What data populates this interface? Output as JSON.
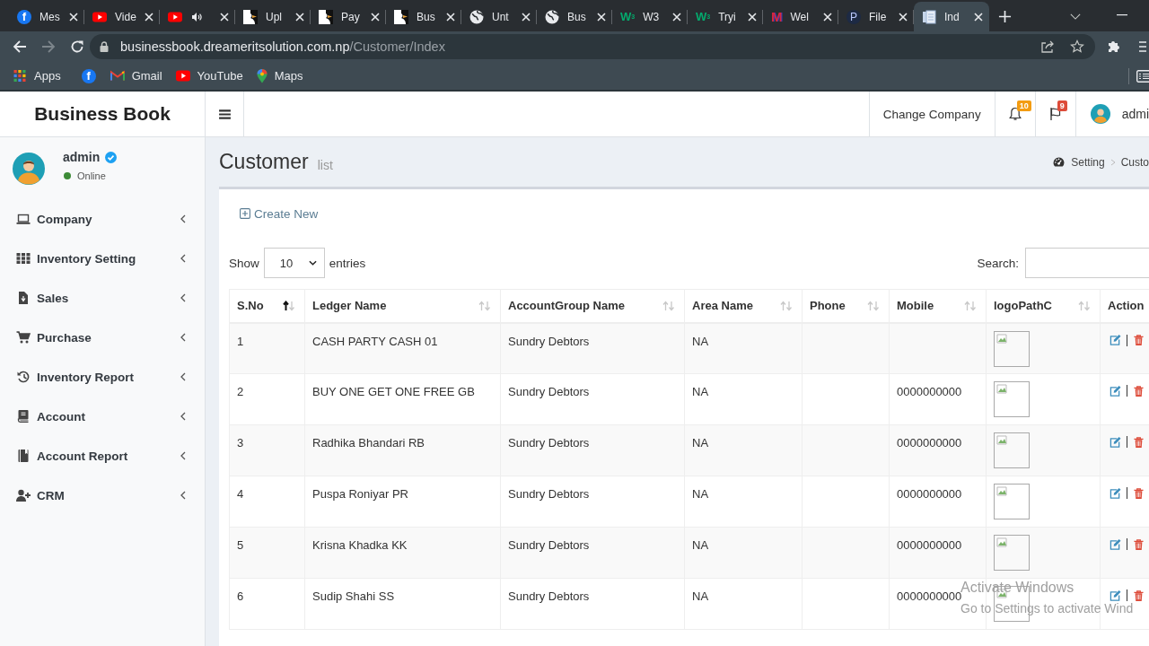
{
  "browser": {
    "tabs": [
      {
        "kind": "fb",
        "mark": "f",
        "title": "Mes",
        "audio": false,
        "selected": false
      },
      {
        "kind": "video",
        "title": "Vide",
        "audio": false,
        "selected": false
      },
      {
        "kind": "video",
        "audio": true,
        "selected": false
      },
      {
        "kind": "bird",
        "title": "Upl",
        "audio": false,
        "selected": false
      },
      {
        "kind": "bird",
        "title": "Pay",
        "audio": false,
        "selected": false
      },
      {
        "kind": "bird",
        "title": "Bus",
        "audio": false,
        "selected": false
      },
      {
        "kind": "globe",
        "title": "Unt",
        "audio": false,
        "selected": false
      },
      {
        "kind": "globe",
        "title": "Bus",
        "audio": false,
        "selected": false
      },
      {
        "kind": "wmark",
        "mark": "W$^{3}$",
        "title": "W3",
        "audio": false,
        "selected": false
      },
      {
        "kind": "wmark",
        "mark": "W$^{3}$",
        "title": "Tryi",
        "audio": false,
        "selected": false
      },
      {
        "kind": "mmark",
        "mark": "M",
        "title": "Wel",
        "audio": false,
        "selected": false
      },
      {
        "kind": "pmark",
        "mark": "P",
        "title": "File",
        "audio": false,
        "selected": false
      },
      {
        "kind": "doc",
        "title": "Ind",
        "audio": false,
        "selected": true
      }
    ],
    "navigation": {
      "back_enabled": true,
      "forward_enabled": false
    },
    "address": {
      "host": "businessbook.dreameritsolution.com.np",
      "path": "/Customer/Index"
    },
    "bookmarks": [
      {
        "kind": "apps",
        "label": "Apps"
      },
      {
        "kind": "fb",
        "mark": "f"
      },
      {
        "kind": "mail",
        "label": "Gmail"
      },
      {
        "kind": "video",
        "label": "YouTube"
      },
      {
        "kind": "pin",
        "label": "Maps"
      }
    ]
  },
  "app": {
    "brand": "Business Book",
    "header": {
      "change_company": "Change Company",
      "notifications": [
        {
          "kind": "bell",
          "count": "10",
          "color": "#f39c12"
        },
        {
          "kind": "flag",
          "count": "9",
          "color": "#dd4b39"
        }
      ],
      "user": "admi"
    },
    "sidebar": {
      "user": {
        "name": "admin",
        "verified": true,
        "status": "Online"
      },
      "items": [
        {
          "label": "Company",
          "kind": "laptop",
          "expanded": false
        },
        {
          "label": "Inventory Setting",
          "kind": "grid",
          "expanded": false
        },
        {
          "label": "Sales",
          "kind": "invoice",
          "expanded": false
        },
        {
          "label": "Purchase",
          "kind": "cart",
          "expanded": false
        },
        {
          "label": "Inventory Report",
          "kind": "history",
          "expanded": false
        },
        {
          "label": "Account",
          "kind": "book",
          "expanded": false
        },
        {
          "label": "Account Report",
          "kind": "ledger",
          "expanded": false
        },
        {
          "label": "CRM",
          "kind": "userplus",
          "expanded": false
        }
      ]
    },
    "page": {
      "title": "Customer",
      "subtitle": "list",
      "breadcrumb": [
        "Setting",
        "Custo"
      ]
    },
    "list": {
      "create": "Create New",
      "show": "Show",
      "page_size": "10",
      "entries": "entries",
      "search_label": "Search:"
    },
    "table": {
      "columns": [
        {
          "label": "S.No",
          "kind": "text",
          "sortable": true,
          "sorted": true
        },
        {
          "label": "Ledger Name",
          "kind": "text",
          "sortable": true,
          "sorted": false
        },
        {
          "label": "AccountGroup Name",
          "kind": "text",
          "sortable": true,
          "sorted": false
        },
        {
          "label": "Area Name",
          "kind": "text",
          "sortable": true,
          "sorted": false
        },
        {
          "label": "Phone",
          "kind": "text",
          "sortable": true,
          "sorted": false
        },
        {
          "label": "Mobile",
          "kind": "text",
          "sortable": true,
          "sorted": false
        },
        {
          "label": "logoPathC",
          "kind": "image",
          "sortable": true,
          "sorted": false
        },
        {
          "label": "Action",
          "kind": "actions",
          "sortable": false
        }
      ],
      "rows": [
        {
          "s_no": "1",
          "ledger_name": "CASH PARTY CASH 01",
          "account_group_name": "Sundry Debtors",
          "area_name": "NA"
        },
        {
          "s_no": "2",
          "ledger_name": "BUY ONE GET ONE FREE GB",
          "account_group_name": "Sundry Debtors",
          "area_name": "NA",
          "mobile": "0000000000"
        },
        {
          "s_no": "3",
          "ledger_name": "Radhika Bhandari RB",
          "account_group_name": "Sundry Debtors",
          "area_name": "NA",
          "mobile": "0000000000"
        },
        {
          "s_no": "4",
          "ledger_name": "Puspa Roniyar PR",
          "account_group_name": "Sundry Debtors",
          "area_name": "NA",
          "mobile": "0000000000"
        },
        {
          "s_no": "5",
          "ledger_name": "Krisna Khadka KK",
          "account_group_name": "Sundry Debtors",
          "area_name": "NA",
          "mobile": "0000000000"
        },
        {
          "s_no": "6",
          "ledger_name": "Sudip Shahi SS",
          "account_group_name": "Sundry Debtors",
          "area_name": "NA",
          "mobile": "0000000000"
        }
      ]
    }
  },
  "activation_notice": {
    "title": "Activate Windows",
    "text": "Go to Settings to activate Wind"
  }
}
